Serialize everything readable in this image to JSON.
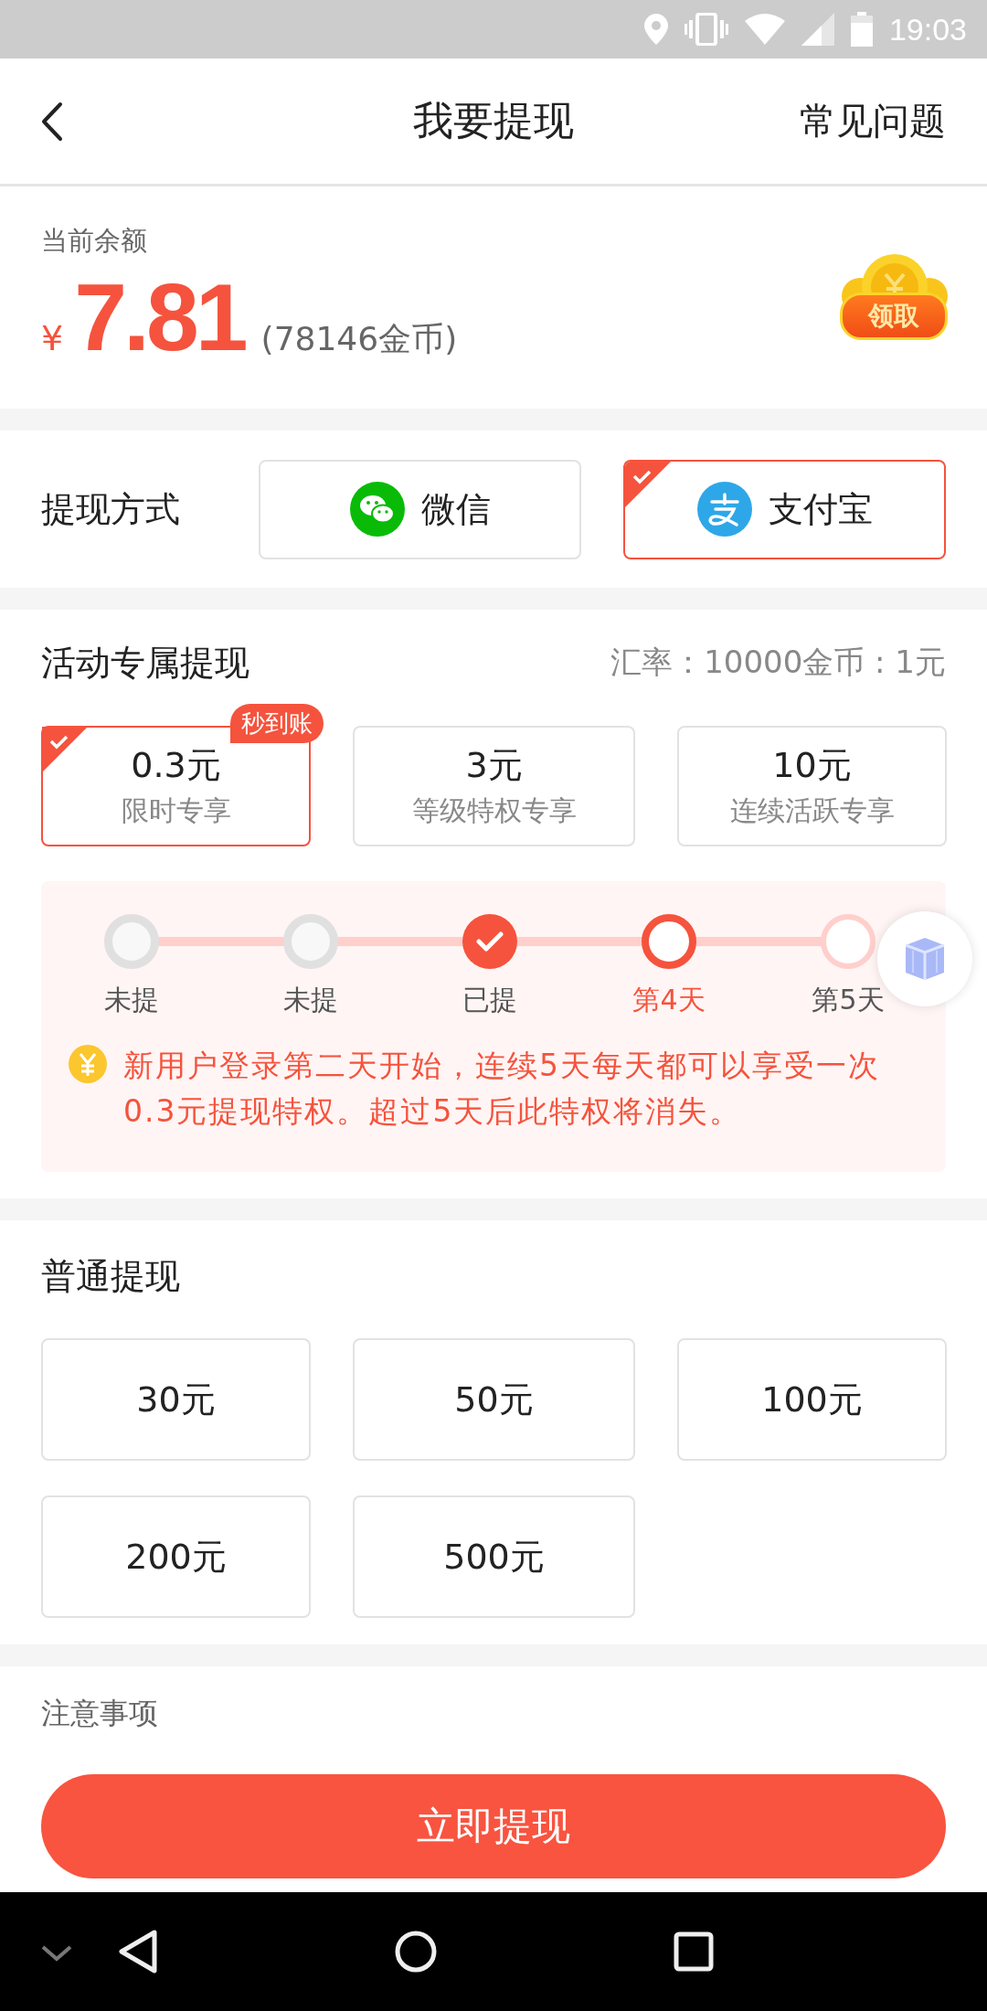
{
  "status_bar": {
    "time": "19:03"
  },
  "header": {
    "title": "我要提现",
    "action": "常见问题"
  },
  "balance": {
    "label": "当前余额",
    "currency": "¥",
    "amount": "7.81",
    "coins": "(78146金币)",
    "claim": "领取"
  },
  "payment": {
    "label": "提现方式",
    "methods": [
      {
        "kind": "wechat",
        "label": "微信",
        "selected": false
      },
      {
        "kind": "alipay",
        "label": "支付宝",
        "selected": true
      }
    ]
  },
  "activity": {
    "title": "活动专属提现",
    "rate": "汇率：10000金币 : 1元",
    "options": [
      {
        "amount": "0.3元",
        "note": "限时专享",
        "badge": "秒到账",
        "selected": true
      },
      {
        "amount": "3元",
        "note": "等级特权专享",
        "selected": false
      },
      {
        "amount": "10元",
        "note": "连续活跃专享",
        "selected": false
      }
    ],
    "steps": [
      {
        "label": "未提",
        "kind": "missed"
      },
      {
        "label": "未提",
        "kind": "missed"
      },
      {
        "label": "已提",
        "kind": "done"
      },
      {
        "label": "第4天",
        "kind": "current"
      },
      {
        "label": "第5天",
        "kind": "upcoming"
      }
    ],
    "notice": "新用户登录第二天开始，连续5天每天都可以享受一次0.3元提现特权。超过5天后此特权将消失。"
  },
  "normal": {
    "title": "普通提现",
    "options": [
      {
        "amount": "30元",
        "selected": false
      },
      {
        "amount": "50元",
        "selected": false
      },
      {
        "amount": "100元",
        "selected": false
      },
      {
        "amount": "200元",
        "selected": false
      },
      {
        "amount": "500元",
        "selected": false
      }
    ]
  },
  "notes": {
    "title": "注意事项"
  },
  "submit": "立即提现"
}
